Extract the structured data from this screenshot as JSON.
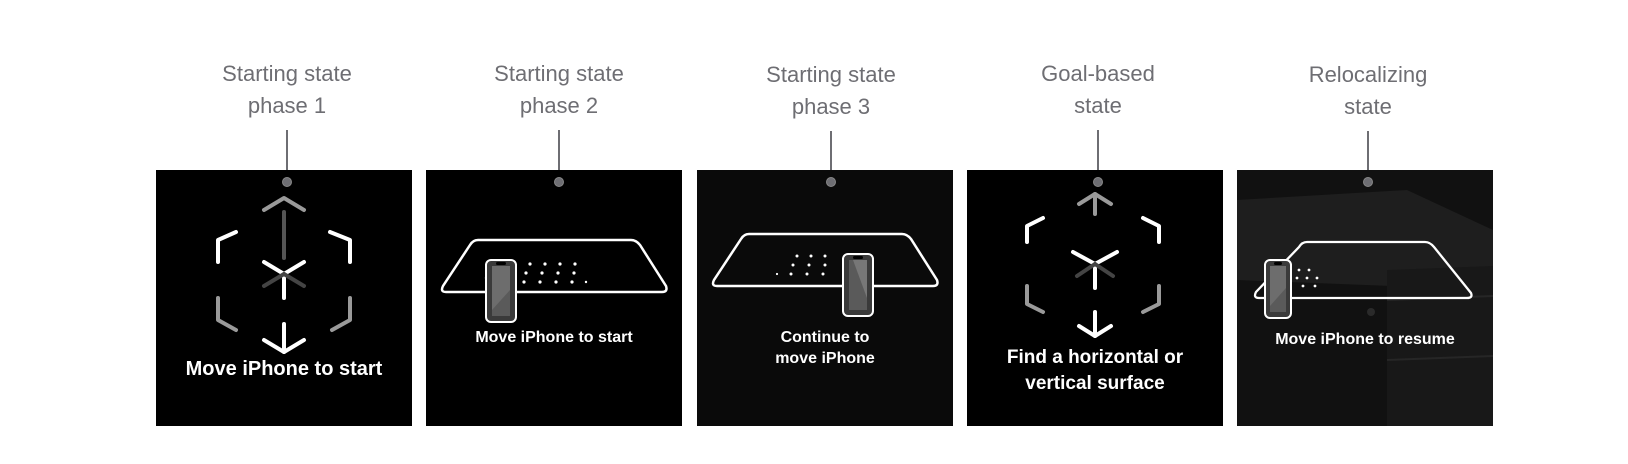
{
  "states": [
    {
      "id": "start-1",
      "label_lines": [
        "Starting state",
        "phase 1"
      ],
      "caption_lines": [
        "Move iPhone to start"
      ]
    },
    {
      "id": "start-2",
      "label_lines": [
        "Starting state",
        "phase 2"
      ],
      "caption_lines": [
        "Move iPhone to start"
      ]
    },
    {
      "id": "start-3",
      "label_lines": [
        "Starting state",
        "phase 3"
      ],
      "caption_lines": [
        "Continue to",
        "move iPhone"
      ]
    },
    {
      "id": "goal",
      "label_lines": [
        "Goal-based",
        "state"
      ],
      "caption_lines": [
        "Find a horizontal or",
        "vertical surface"
      ]
    },
    {
      "id": "reloc",
      "label_lines": [
        "Relocalizing",
        "state"
      ],
      "caption_lines": [
        "Move iPhone to resume"
      ]
    }
  ],
  "icons": [
    "cube-chevrons-icon",
    "plane-outline-icon",
    "iphone-icon"
  ],
  "colors": {
    "panel": "#000000",
    "label": "#6e6e73",
    "caption": "#ffffff"
  }
}
